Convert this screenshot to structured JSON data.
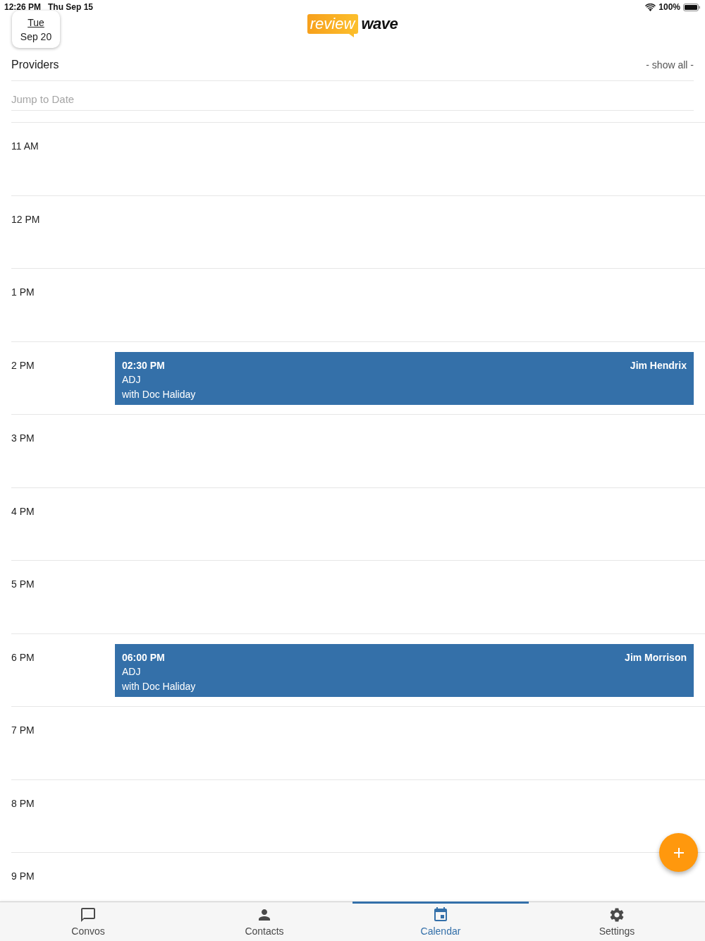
{
  "status_bar": {
    "time": "12:26 PM",
    "date": "Thu Sep 15",
    "battery": "100%"
  },
  "header": {
    "date_button": {
      "weekday": "Tue",
      "date": "Sep 20"
    },
    "logo": {
      "part_1": "review",
      "part_2": "wave"
    }
  },
  "providers": {
    "label": "Providers",
    "action": "- show all -"
  },
  "jump_to_date": {
    "placeholder": "Jump to Date"
  },
  "hours": [
    {
      "label": "11 AM"
    },
    {
      "label": "12 PM"
    },
    {
      "label": "1 PM"
    },
    {
      "label": "2 PM",
      "events": [
        {
          "time": "02:30 PM",
          "type": "ADJ",
          "with": "with Doc Haliday",
          "client": "Jim Hendrix"
        }
      ]
    },
    {
      "label": "3 PM"
    },
    {
      "label": "4 PM"
    },
    {
      "label": "5 PM"
    },
    {
      "label": "6 PM",
      "events": [
        {
          "time": "06:00 PM",
          "type": "ADJ",
          "with": "with Doc Haliday",
          "client": "Jim Morrison"
        }
      ]
    },
    {
      "label": "7 PM"
    },
    {
      "label": "8 PM"
    },
    {
      "label": "9 PM"
    }
  ],
  "tabs": [
    {
      "label": "Convos",
      "selected": false
    },
    {
      "label": "Contacts",
      "selected": false
    },
    {
      "label": "Calendar",
      "selected": true
    },
    {
      "label": "Settings",
      "selected": false
    }
  ]
}
